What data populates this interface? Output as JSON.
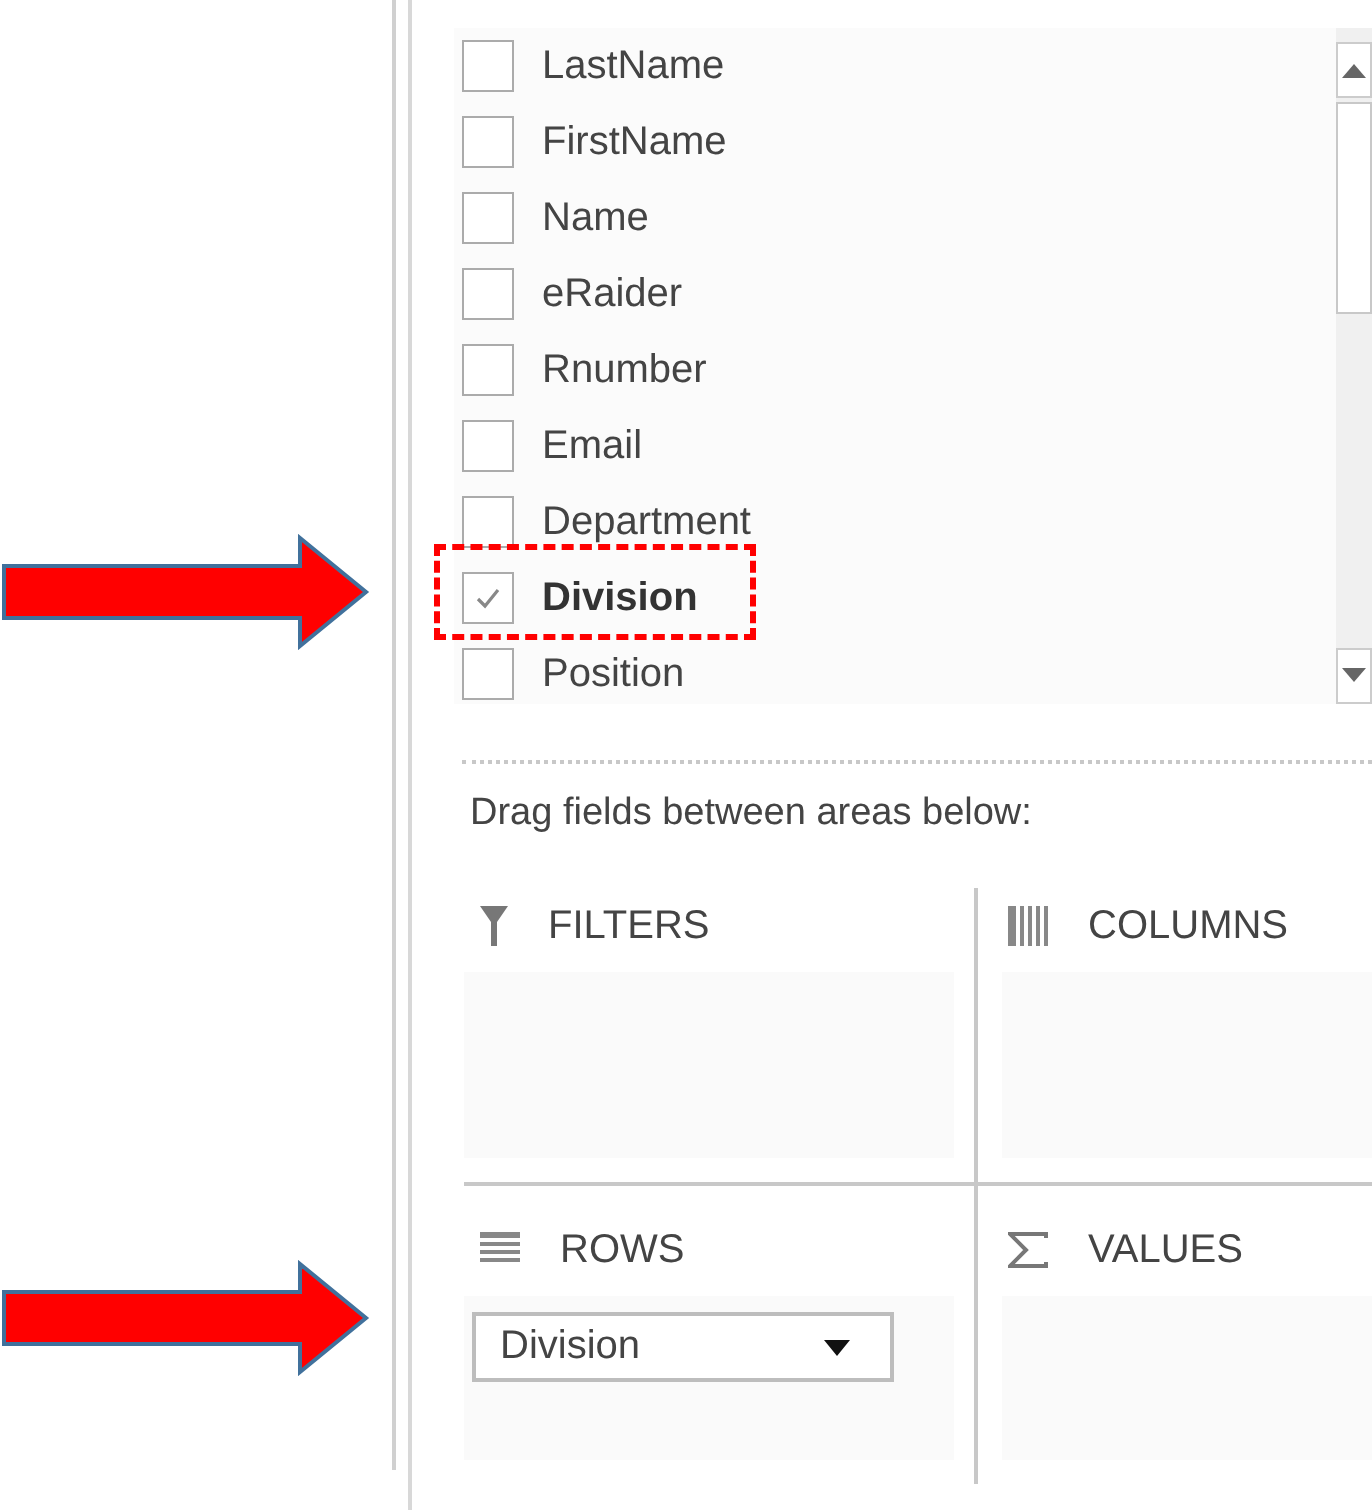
{
  "fields": [
    {
      "label": "LastName",
      "checked": false
    },
    {
      "label": "FirstName",
      "checked": false
    },
    {
      "label": "Name",
      "checked": false
    },
    {
      "label": "eRaider",
      "checked": false
    },
    {
      "label": "Rnumber",
      "checked": false
    },
    {
      "label": "Email",
      "checked": false
    },
    {
      "label": "Department",
      "checked": false
    },
    {
      "label": "Division",
      "checked": true
    },
    {
      "label": "Position",
      "checked": false
    }
  ],
  "instruction": "Drag fields between areas below:",
  "areas": [
    {
      "kind": "filters",
      "label": "FILTERS"
    },
    {
      "kind": "columns",
      "label": "COLUMNS"
    },
    {
      "kind": "rows",
      "label": "ROWS",
      "items": [
        "Division"
      ]
    },
    {
      "kind": "values",
      "label": "VALUES"
    }
  ]
}
